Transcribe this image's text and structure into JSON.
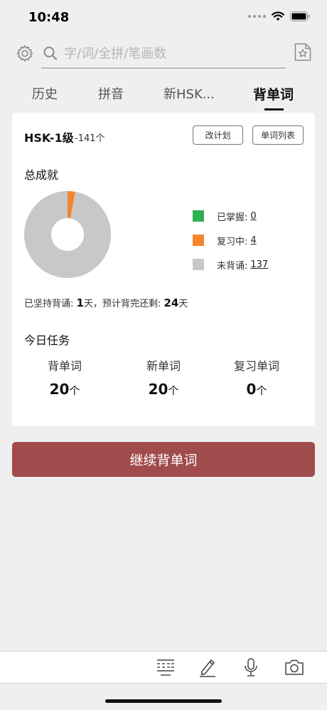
{
  "status": {
    "time": "10:48"
  },
  "search": {
    "placeholder": "字/词/全拼/笔画数"
  },
  "tabs": [
    {
      "label": "历史"
    },
    {
      "label": "拼音"
    },
    {
      "label": "新HSK..."
    },
    {
      "label": "背单词",
      "active": true
    }
  ],
  "card": {
    "level": "HSK-1级",
    "level_count": "-141个",
    "change_plan_label": "改计划",
    "word_list_label": "单词列表",
    "achievement_title": "总成就",
    "legend": [
      {
        "label": "已掌握:",
        "value": "0",
        "color": "#2db24d"
      },
      {
        "label": "复习中:",
        "value": "4",
        "color": "#f5862d"
      },
      {
        "label": "未背诵:",
        "value": "137",
        "color": "#c8c8c8"
      }
    ],
    "streak": {
      "prefix": "已坚持背诵: ",
      "days": "1",
      "middle": "天，预计背完还剩: ",
      "remaining": "24",
      "suffix": "天"
    },
    "today_title": "今日任务",
    "tasks": [
      {
        "label": "背单词",
        "value": "20",
        "unit": "个"
      },
      {
        "label": "新单词",
        "value": "20",
        "unit": "个"
      },
      {
        "label": "复习单词",
        "value": "0",
        "unit": "个"
      }
    ]
  },
  "chart_data": {
    "type": "pie",
    "categories": [
      "已掌握",
      "复习中",
      "未背诵"
    ],
    "values": [
      0,
      4,
      137
    ],
    "colors": [
      "#2db24d",
      "#f5862d",
      "#c8c8c8"
    ]
  },
  "continue_label": "继续背单词",
  "bottom_icons": [
    "keyboard-icon",
    "pen-icon",
    "microphone-icon",
    "camera-icon"
  ]
}
